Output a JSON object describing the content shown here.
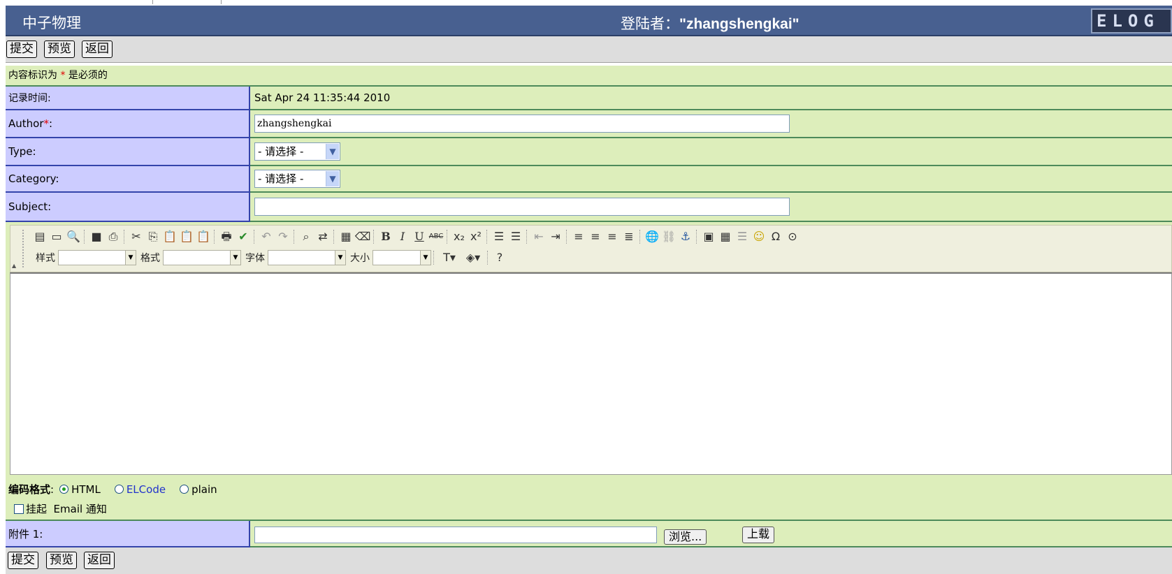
{
  "header": {
    "title": "中子物理",
    "login_label": "登陆者：",
    "login_user": "\"zhangshengkai\"",
    "logo_text": "ELOG",
    "bg_color": "#486090"
  },
  "buttons_top": {
    "submit": "提交",
    "preview": "预览",
    "back": "返回"
  },
  "required_note": {
    "prefix": "内容标识为",
    "star": "*",
    "suffix": "是必须的"
  },
  "fields": {
    "time": {
      "label": "记录时间:",
      "value": "Sat Apr 24 11:35:44 2010"
    },
    "author": {
      "label": "Author",
      "star": "*",
      "colon": ":",
      "value": "zhangshengkai"
    },
    "type": {
      "label": "Type:",
      "selected": "- 请选择 -"
    },
    "category": {
      "label": "Category:",
      "selected": "- 请选择 -"
    },
    "subject": {
      "label": "Subject:",
      "value": ""
    }
  },
  "editor": {
    "combo_style": "样式",
    "combo_format": "格式",
    "combo_font": "字体",
    "combo_size": "大小",
    "toolbar_icons": [
      "source-icon",
      "new-page-icon",
      "preview-icon",
      "save-icon",
      "print-preview-icon",
      "cut-icon",
      "copy-icon",
      "paste-icon",
      "paste-text-icon",
      "paste-word-icon",
      "print-icon",
      "spellcheck-icon",
      "undo-icon",
      "redo-icon",
      "find-icon",
      "replace-icon",
      "select-all-icon",
      "remove-format-icon",
      "bold-icon",
      "italic-icon",
      "underline-icon",
      "strike-icon",
      "subscript-icon",
      "superscript-icon",
      "ordered-list-icon",
      "unordered-list-icon",
      "outdent-icon",
      "indent-icon",
      "align-left-icon",
      "align-center-icon",
      "align-right-icon",
      "justify-icon",
      "link-icon",
      "unlink-icon",
      "anchor-icon",
      "image-icon",
      "table-icon",
      "rule-icon",
      "smiley-icon",
      "special-char-icon",
      "page-break-icon"
    ]
  },
  "encoding": {
    "label": "编码格式",
    "colon": ":",
    "options": [
      "HTML",
      "ELCode",
      "plain"
    ],
    "selected": "HTML"
  },
  "email": {
    "label": "挂起  Email 通知"
  },
  "attachment": {
    "label": "附件 1:",
    "browse": "浏览...",
    "upload": "上载"
  },
  "buttons_bottom": {
    "submit": "提交",
    "preview": "预览",
    "back": "返回"
  }
}
